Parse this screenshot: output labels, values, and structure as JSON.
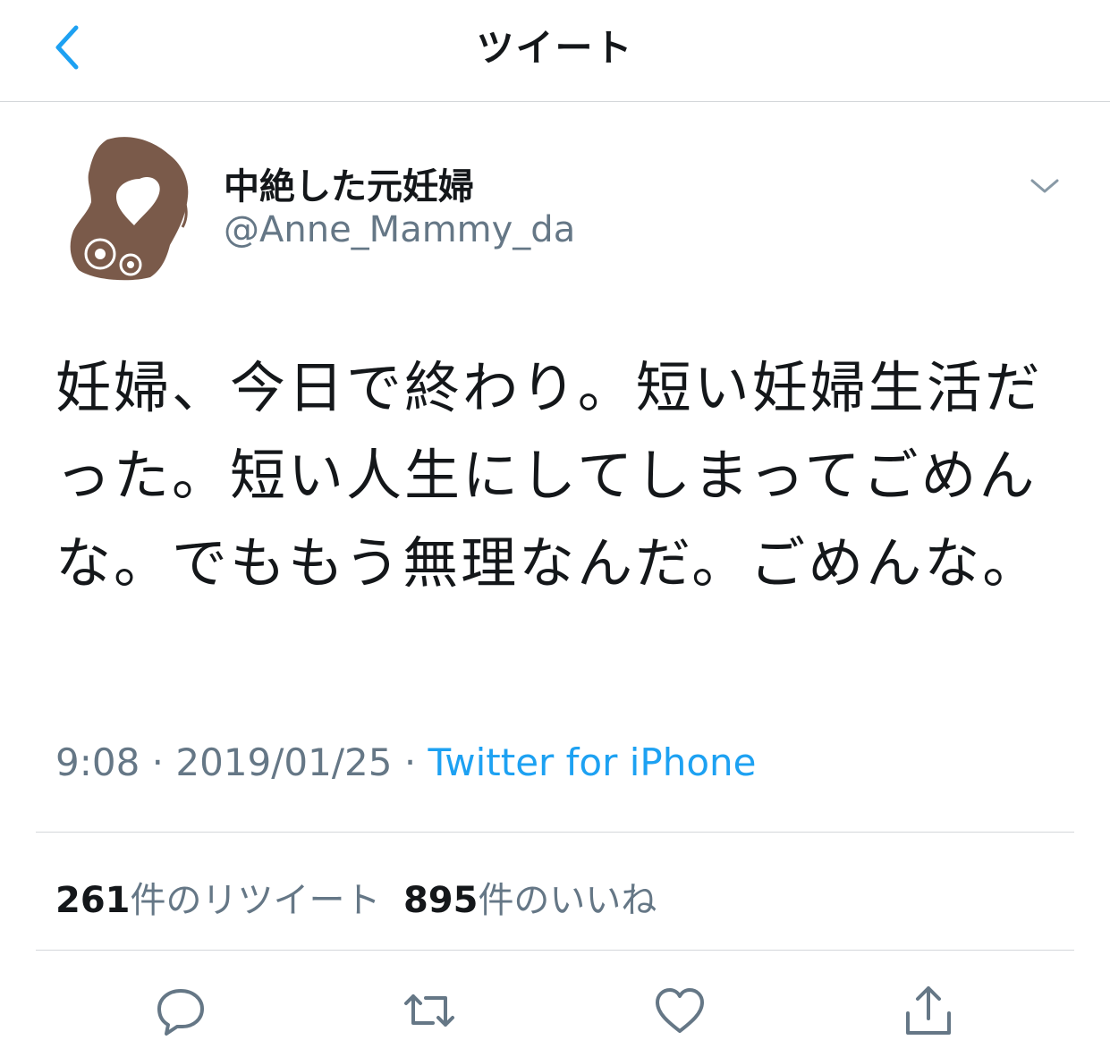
{
  "header": {
    "title": "ツイート"
  },
  "user": {
    "display_name": "中絶した元妊婦",
    "handle": "@Anne_Mammy_da"
  },
  "tweet": {
    "text": "妊婦、今日で終わり。短い妊婦生活だった。短い人生にしてしまってごめんな。でももう無理なんだ。ごめんな。",
    "time": "9:08",
    "sep1": " · ",
    "date": "2019/01/25",
    "sep2": " · ",
    "source": "Twitter for iPhone"
  },
  "stats": {
    "retweet_count": "261",
    "retweet_label": "件のリツイート",
    "like_count": "895",
    "like_label": "件のいいね"
  },
  "colors": {
    "accent": "#1da1f2",
    "secondary_text": "#657786",
    "avatar_brown": "#7a5a4a"
  },
  "icons": {
    "back": "chevron-left-icon",
    "caret": "chevron-down-icon",
    "reply": "reply-icon",
    "retweet": "retweet-icon",
    "like": "heart-icon",
    "share": "share-icon"
  }
}
